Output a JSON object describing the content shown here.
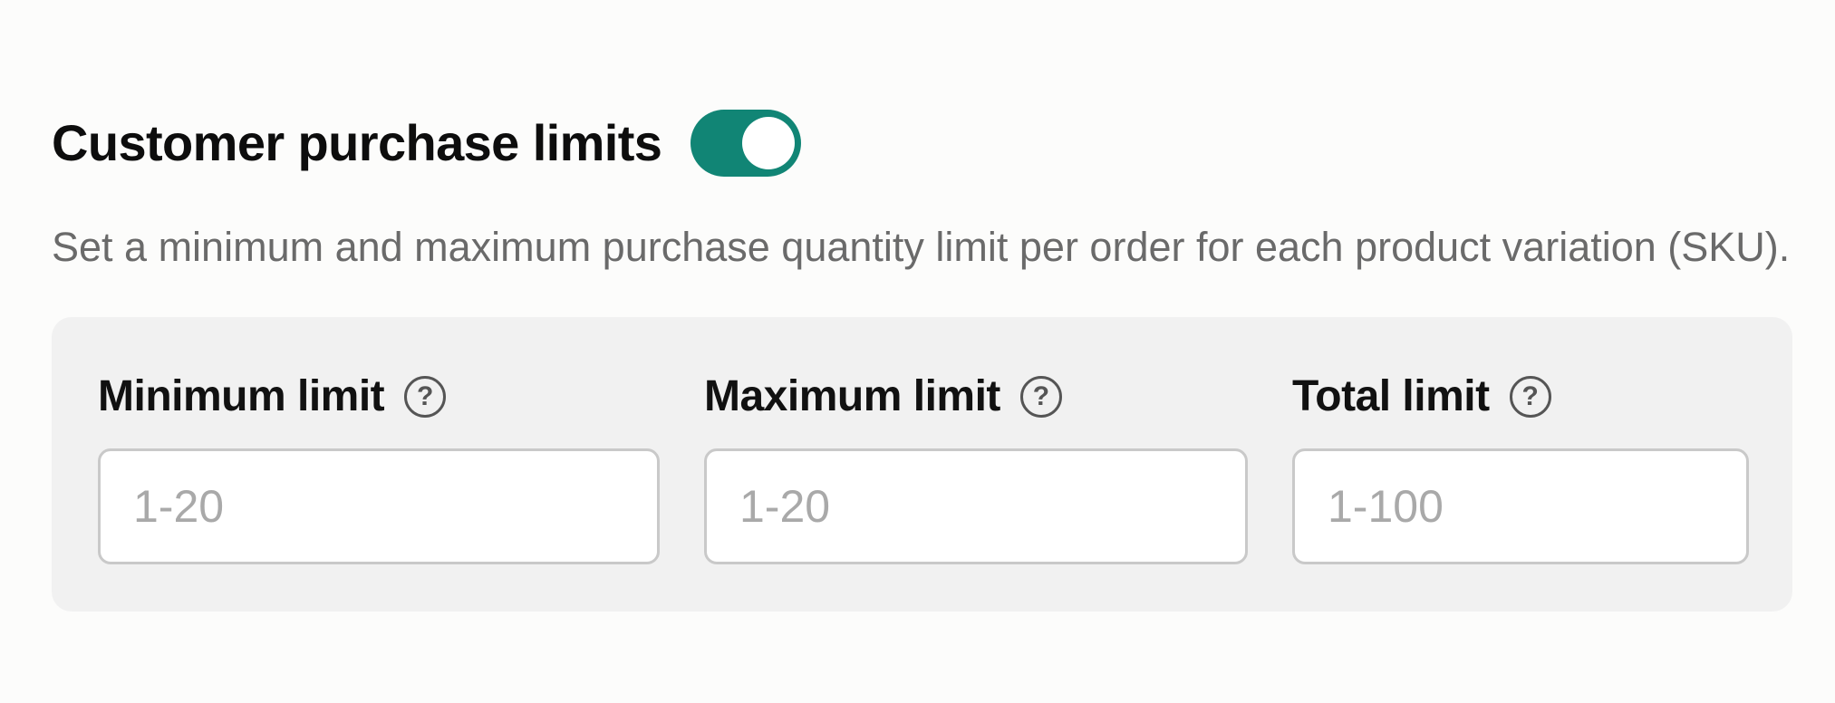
{
  "header": {
    "title": "Customer purchase limits",
    "toggle": {
      "state": "on",
      "color": "#118575"
    }
  },
  "description": "Set a minimum and maximum purchase quantity limit per order for each product variation (SKU).",
  "fields": [
    {
      "label": "Minimum limit",
      "help_icon_glyph": "?",
      "help_icon": "question-circle-icon",
      "placeholder": "1-20",
      "value": ""
    },
    {
      "label": "Maximum limit",
      "help_icon_glyph": "?",
      "help_icon": "question-circle-icon",
      "placeholder": "1-20",
      "value": ""
    },
    {
      "label": "Total limit",
      "help_icon_glyph": "?",
      "help_icon": "question-circle-icon",
      "placeholder": "1-100",
      "value": ""
    }
  ],
  "colors": {
    "accent": "#118575",
    "panel_background": "#f1f1f1",
    "description_text": "#6a6a6a",
    "input_border": "#c9c9c9"
  }
}
